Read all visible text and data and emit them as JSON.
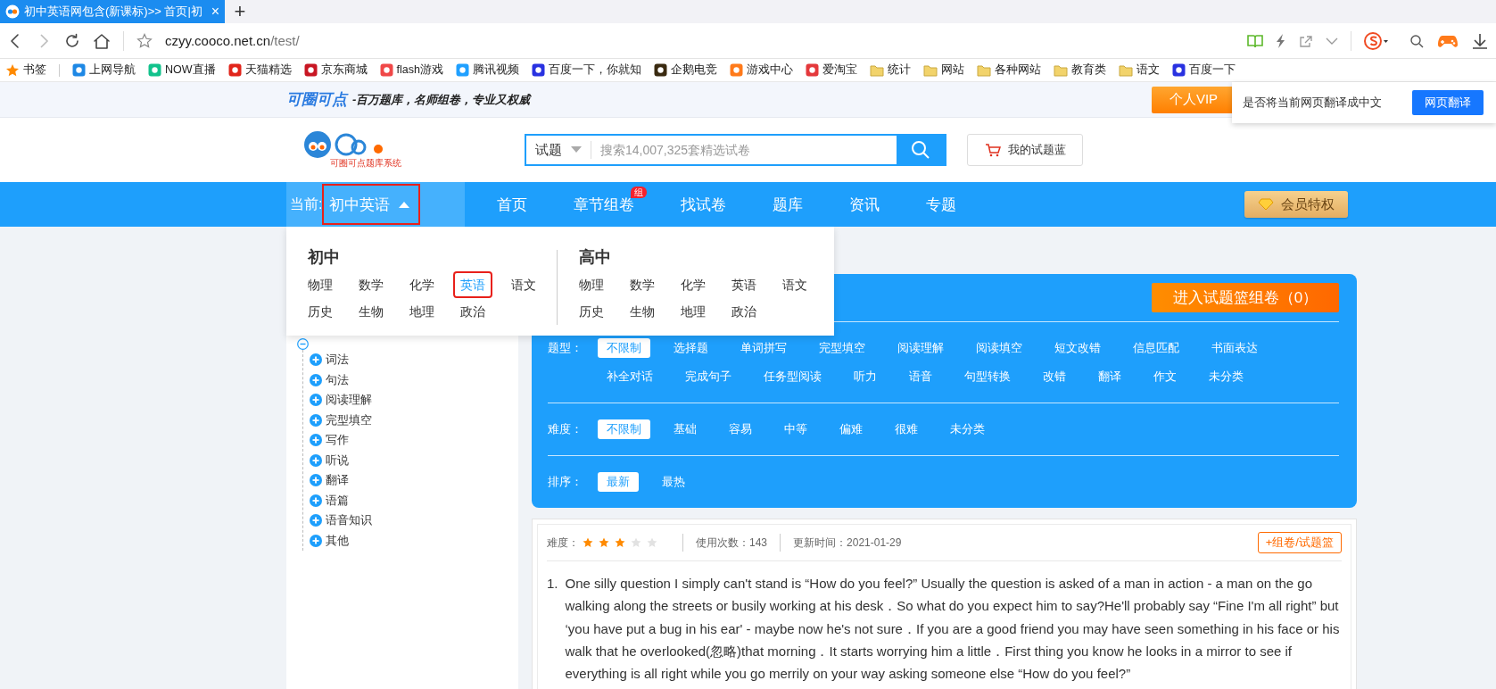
{
  "browser": {
    "tab_title": "初中英语网包含(新课标)>> 首页|初",
    "tab_close": "×",
    "new_tab": "+",
    "url_host": "czyy.cooco.net.cn",
    "url_path": "/test/",
    "bookmarks": [
      {
        "label": "书签",
        "kind": "star",
        "color": "#ff8a00"
      },
      {
        "label": "上网导航",
        "kind": "site",
        "color": "#1e88e5"
      },
      {
        "label": "NOW直播",
        "kind": "site",
        "color": "#12c28c"
      },
      {
        "label": "天猫精选",
        "kind": "site",
        "color": "#e1251b"
      },
      {
        "label": "京东商城",
        "kind": "site",
        "color": "#c81623"
      },
      {
        "label": "flash游戏",
        "kind": "site",
        "color": "#f04848"
      },
      {
        "label": "腾讯视频",
        "kind": "site",
        "color": "#20a0ff"
      },
      {
        "label": "百度一下，你就知",
        "kind": "site",
        "color": "#2932e1"
      },
      {
        "label": "企鹅电竞",
        "kind": "site",
        "color": "#3a2a10"
      },
      {
        "label": "游戏中心",
        "kind": "site",
        "color": "#ff7a1a"
      },
      {
        "label": "爱淘宝",
        "kind": "site",
        "color": "#e4393c"
      },
      {
        "label": "统计",
        "kind": "folder",
        "color": "#f2d36b"
      },
      {
        "label": "网站",
        "kind": "folder",
        "color": "#f2d36b"
      },
      {
        "label": "各种网站",
        "kind": "folder",
        "color": "#f2d36b"
      },
      {
        "label": "教育类",
        "kind": "folder",
        "color": "#f2d36b"
      },
      {
        "label": "语文",
        "kind": "folder",
        "color": "#f2d36b"
      },
      {
        "label": "百度一下",
        "kind": "site",
        "color": "#2932e1"
      }
    ]
  },
  "top_strip": {
    "brand": "可圈可点",
    "slogan": "-百万题库，名师组卷，专业又权威",
    "vip_button": "个人VIP"
  },
  "translate_prompt": {
    "text": "是否将当前网页翻译成中文",
    "button": "网页翻译"
  },
  "header": {
    "logo_caption": "可圈可点题库系统",
    "search": {
      "scope": "试题",
      "placeholder": "搜索14,007,325套精选试卷"
    },
    "basket_button": "我的试题蓝"
  },
  "nav": {
    "current_label": "当前:",
    "current_subject": "初中英语",
    "expanded": true,
    "highlighted": true,
    "items": [
      {
        "label": "首页"
      },
      {
        "label": "章节组卷",
        "badge": "组"
      },
      {
        "label": "找试卷"
      },
      {
        "label": "题库"
      },
      {
        "label": "资讯"
      },
      {
        "label": "专题"
      }
    ],
    "member_button": "会员特权"
  },
  "subject_menu": {
    "groups": [
      {
        "title": "初中",
        "subjects": [
          {
            "label": "物理",
            "selected": false,
            "highlighted": false
          },
          {
            "label": "数学",
            "selected": false,
            "highlighted": false
          },
          {
            "label": "化学",
            "selected": false,
            "highlighted": false
          },
          {
            "label": "英语",
            "selected": true,
            "highlighted": true
          },
          {
            "label": "语文",
            "selected": false,
            "highlighted": false
          },
          {
            "label": "历史",
            "selected": false,
            "highlighted": false
          },
          {
            "label": "生物",
            "selected": false,
            "highlighted": false
          },
          {
            "label": "地理",
            "selected": false,
            "highlighted": false
          },
          {
            "label": "政治",
            "selected": false,
            "highlighted": false
          }
        ]
      },
      {
        "title": "高中",
        "subjects": [
          {
            "label": "物理",
            "selected": false,
            "highlighted": false
          },
          {
            "label": "数学",
            "selected": false,
            "highlighted": false
          },
          {
            "label": "化学",
            "selected": false,
            "highlighted": false
          },
          {
            "label": "英语",
            "selected": false,
            "highlighted": false
          },
          {
            "label": "语文",
            "selected": false,
            "highlighted": false
          },
          {
            "label": "历史",
            "selected": false,
            "highlighted": false
          },
          {
            "label": "生物",
            "selected": false,
            "highlighted": false
          },
          {
            "label": "地理",
            "selected": false,
            "highlighted": false
          },
          {
            "label": "政治",
            "selected": false,
            "highlighted": false
          }
        ]
      }
    ]
  },
  "sidebar": {
    "root_expanded": true,
    "items": [
      {
        "label": "词法",
        "expanded": false
      },
      {
        "label": "句法",
        "expanded": false
      },
      {
        "label": "阅读理解",
        "expanded": false
      },
      {
        "label": "完型填空",
        "expanded": false
      },
      {
        "label": "写作",
        "expanded": false
      },
      {
        "label": "听说",
        "expanded": false
      },
      {
        "label": "翻译",
        "expanded": false
      },
      {
        "label": "语篇",
        "expanded": false
      },
      {
        "label": "语音知识",
        "expanded": false
      },
      {
        "label": "其他",
        "expanded": false
      }
    ]
  },
  "filter_panel": {
    "basket_button": "进入试题篮组卷（0）",
    "rows": [
      {
        "label": "题型：",
        "options": [
          {
            "label": "不限制",
            "selected": true
          },
          {
            "label": "选择题",
            "selected": false
          },
          {
            "label": "单词拼写",
            "selected": false
          },
          {
            "label": "完型填空",
            "selected": false
          },
          {
            "label": "阅读理解",
            "selected": false
          },
          {
            "label": "阅读填空",
            "selected": false
          },
          {
            "label": "短文改错",
            "selected": false
          },
          {
            "label": "信息匹配",
            "selected": false
          },
          {
            "label": "书面表达",
            "selected": false
          },
          {
            "label": "补全对话",
            "selected": false
          },
          {
            "label": "完成句子",
            "selected": false
          },
          {
            "label": "任务型阅读",
            "selected": false
          },
          {
            "label": "听力",
            "selected": false
          },
          {
            "label": "语音",
            "selected": false
          },
          {
            "label": "句型转换",
            "selected": false
          },
          {
            "label": "改错",
            "selected": false
          },
          {
            "label": "翻译",
            "selected": false
          },
          {
            "label": "作文",
            "selected": false
          },
          {
            "label": "未分类",
            "selected": false
          }
        ]
      },
      {
        "label": "难度：",
        "options": [
          {
            "label": "不限制",
            "selected": true
          },
          {
            "label": "基础",
            "selected": false
          },
          {
            "label": "容易",
            "selected": false
          },
          {
            "label": "中等",
            "selected": false
          },
          {
            "label": "偏难",
            "selected": false
          },
          {
            "label": "很难",
            "selected": false
          },
          {
            "label": "未分类",
            "selected": false
          }
        ]
      },
      {
        "label": "排序：",
        "options": [
          {
            "label": "最新",
            "selected": true
          },
          {
            "label": "最热",
            "selected": false
          }
        ]
      }
    ]
  },
  "question": {
    "difficulty_label": "难度：",
    "stars": 3,
    "usage": "使用次数：143",
    "updated": "更新时间：2021-01-29",
    "add_button": "+组卷/试题篮",
    "number": "1.",
    "text": "One silly question I simply can't stand is “How do you feel?” Usually the question is asked of a man in action - a man on the go walking along the streets or busily working at his desk．So what do you expect him to say?He'll probably say “Fine I'm all right” but ‘you have put a bug in his ear' - maybe now he's not sure．If you are a good friend you may have seen something in his face or his walk that he overlooked(忽略)that morning．It starts worrying him a little．First thing you know he looks in a mirror to see if everything is all right while you go merrily on your way asking someone else “How do you feel?”"
  }
}
